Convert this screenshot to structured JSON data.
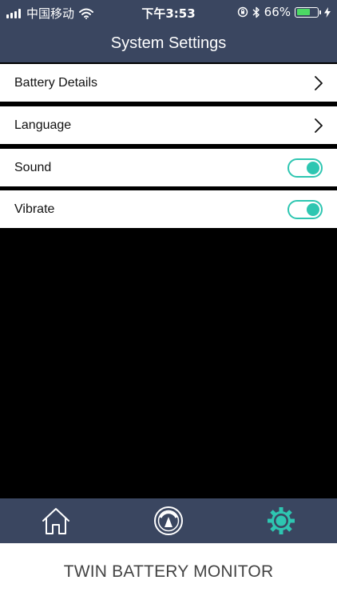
{
  "status_bar": {
    "carrier": "中国移动",
    "time": "下午3:53",
    "battery_percent": "66%",
    "battery_level": 0.66,
    "icons": [
      "signal-icon",
      "wifi-icon",
      "orientation-lock-icon",
      "bluetooth-icon",
      "battery-icon",
      "charging-icon"
    ]
  },
  "header": {
    "title": "System Settings"
  },
  "settings": {
    "items": [
      {
        "label": "Battery Details",
        "control": "chevron-right-icon"
      },
      {
        "label": "Language",
        "control": "chevron-right-icon"
      },
      {
        "label": "Sound",
        "control": "toggle",
        "on": true
      },
      {
        "label": "Vibrate",
        "control": "toggle",
        "on": true
      }
    ]
  },
  "tab_bar": {
    "tabs": [
      {
        "icon": "home-icon",
        "active": false
      },
      {
        "icon": "gauge-icon",
        "active": false
      },
      {
        "icon": "gear-icon",
        "active": true
      }
    ]
  },
  "footer": {
    "text": "TWIN BATTERY MONITOR"
  },
  "colors": {
    "header_bg": "#3a4660",
    "accent": "#2ec6b1",
    "battery_green": "#4cd964",
    "background": "#000000"
  }
}
